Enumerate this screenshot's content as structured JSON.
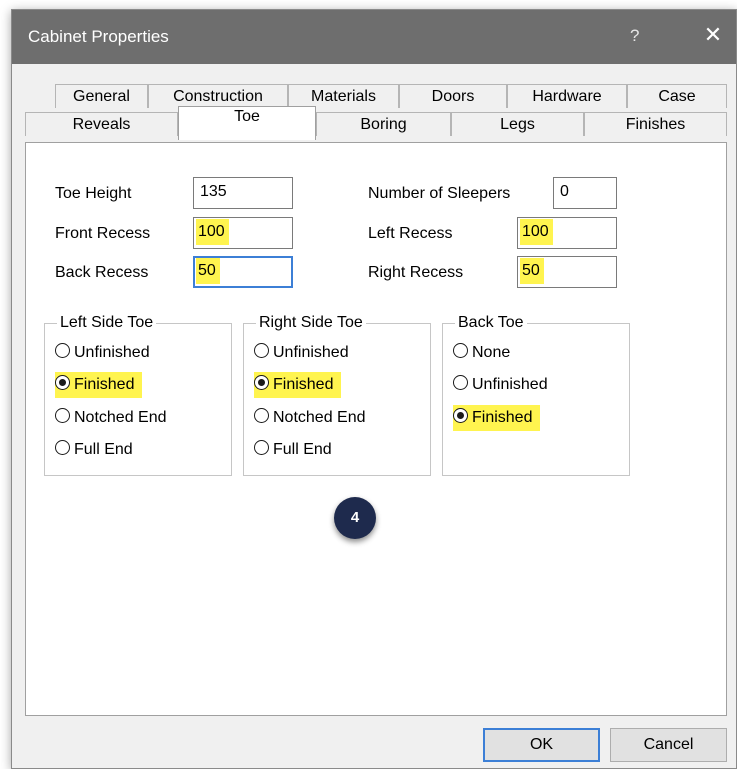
{
  "window": {
    "title": "Cabinet Properties",
    "help_label": "?",
    "close_label": "✕"
  },
  "tabs_row1": [
    "General",
    "Construction",
    "Materials",
    "Doors",
    "Hardware",
    "Case"
  ],
  "tabs_row2": [
    "Reveals",
    "Toe",
    "Boring",
    "Legs",
    "Finishes"
  ],
  "active_tab": "Toe",
  "fields": {
    "toe_height": {
      "label": "Toe Height",
      "value": "135"
    },
    "front_recess": {
      "label": "Front Recess",
      "value": "100"
    },
    "back_recess": {
      "label": "Back Recess",
      "value": "50"
    },
    "number_of_sleepers": {
      "label": "Number of Sleepers",
      "value": "0"
    },
    "left_recess": {
      "label": "Left Recess",
      "value": "100"
    },
    "right_recess": {
      "label": "Right Recess",
      "value": "50"
    }
  },
  "groups": {
    "left_side_toe": {
      "title": "Left Side Toe",
      "options": [
        "Unfinished",
        "Finished",
        "Notched End",
        "Full End"
      ],
      "selected": "Finished"
    },
    "right_side_toe": {
      "title": "Right Side Toe",
      "options": [
        "Unfinished",
        "Finished",
        "Notched End",
        "Full End"
      ],
      "selected": "Finished"
    },
    "back_toe": {
      "title": "Back Toe",
      "options": [
        "None",
        "Unfinished",
        "Finished"
      ],
      "selected": "Finished"
    }
  },
  "step_badge": "4",
  "buttons": {
    "ok": "OK",
    "cancel": "Cancel"
  },
  "colors": {
    "highlight": "#fff44f",
    "titlebar": "#6e6e6e",
    "badge": "#1e2a4d",
    "focus": "#3c7fd6"
  }
}
